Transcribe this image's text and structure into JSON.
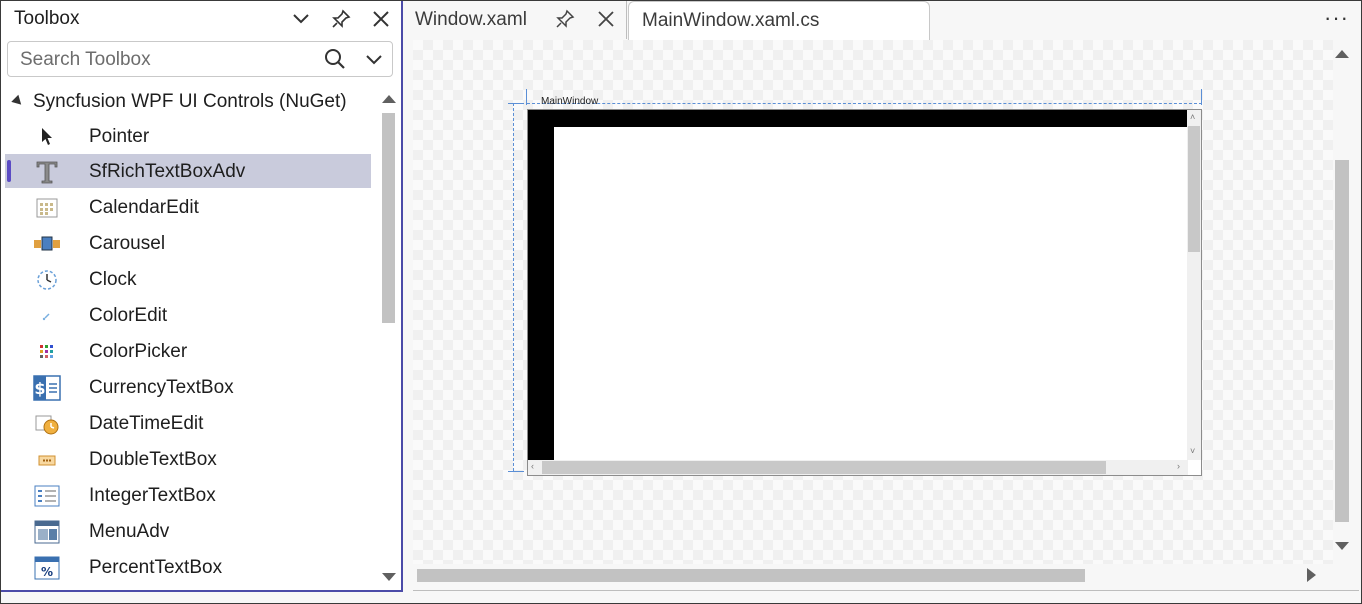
{
  "toolbox": {
    "title": "Toolbox",
    "search_placeholder": "Search Toolbox",
    "group": "Syncfusion WPF UI Controls (NuGet)",
    "items": [
      {
        "label": "Pointer",
        "icon": "pointer-icon"
      },
      {
        "label": "SfRichTextBoxAdv",
        "icon": "text-t-icon",
        "selected": true
      },
      {
        "label": "CalendarEdit",
        "icon": "calendar-icon"
      },
      {
        "label": "Carousel",
        "icon": "carousel-icon"
      },
      {
        "label": "Clock",
        "icon": "clock-icon"
      },
      {
        "label": "ColorEdit",
        "icon": "color-edit-icon"
      },
      {
        "label": "ColorPicker",
        "icon": "color-picker-icon"
      },
      {
        "label": "CurrencyTextBox",
        "icon": "currency-icon"
      },
      {
        "label": "DateTimeEdit",
        "icon": "datetime-icon"
      },
      {
        "label": "DoubleTextBox",
        "icon": "double-textbox-icon"
      },
      {
        "label": "IntegerTextBox",
        "icon": "integer-textbox-icon"
      },
      {
        "label": "MenuAdv",
        "icon": "menu-icon"
      },
      {
        "label": "PercentTextBox",
        "icon": "percent-icon"
      }
    ]
  },
  "tabs": [
    {
      "label": "Window.xaml"
    },
    {
      "label": "MainWindow.xaml.cs"
    }
  ],
  "designer": {
    "window_title": "MainWindow"
  },
  "colors": {
    "accent": "#5b4bc4",
    "selection": "#c9cbdc",
    "guide": "#5b8fd6"
  }
}
